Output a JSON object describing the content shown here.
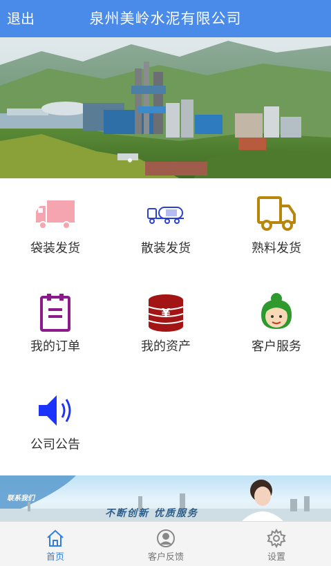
{
  "header": {
    "back_label": "退出",
    "title": "泉州美岭水泥有限公司"
  },
  "menu": [
    {
      "label": "袋装发货",
      "icon": "truck-icon",
      "color": "#f4a5b0"
    },
    {
      "label": "散装发货",
      "icon": "tanker-truck-icon",
      "color": "#2b3fd0"
    },
    {
      "label": "熟料发货",
      "icon": "delivery-truck-icon",
      "color": "#b8860b"
    },
    {
      "label": "我的订单",
      "icon": "clipboard-icon",
      "color": "#8b1a8b"
    },
    {
      "label": "我的资产",
      "icon": "coin-stack-icon",
      "color": "#a31515"
    },
    {
      "label": "客户服务",
      "icon": "customer-service-icon",
      "color": "#2e9a2e"
    },
    {
      "label": "公司公告",
      "icon": "speaker-icon",
      "color": "#1a33ff"
    }
  ],
  "ad_banner": {
    "left_text": "联系我们",
    "slogan": "不断创新 优质服务"
  },
  "tabbar": {
    "items": [
      {
        "label": "首页",
        "icon": "home-icon",
        "active": true
      },
      {
        "label": "客户反馈",
        "icon": "user-icon",
        "active": false
      },
      {
        "label": "设置",
        "icon": "gear-icon",
        "active": false
      }
    ]
  },
  "colors": {
    "header_bg": "#4a8ae8",
    "tab_active": "#2f7de0",
    "tab_inactive": "#777777"
  }
}
